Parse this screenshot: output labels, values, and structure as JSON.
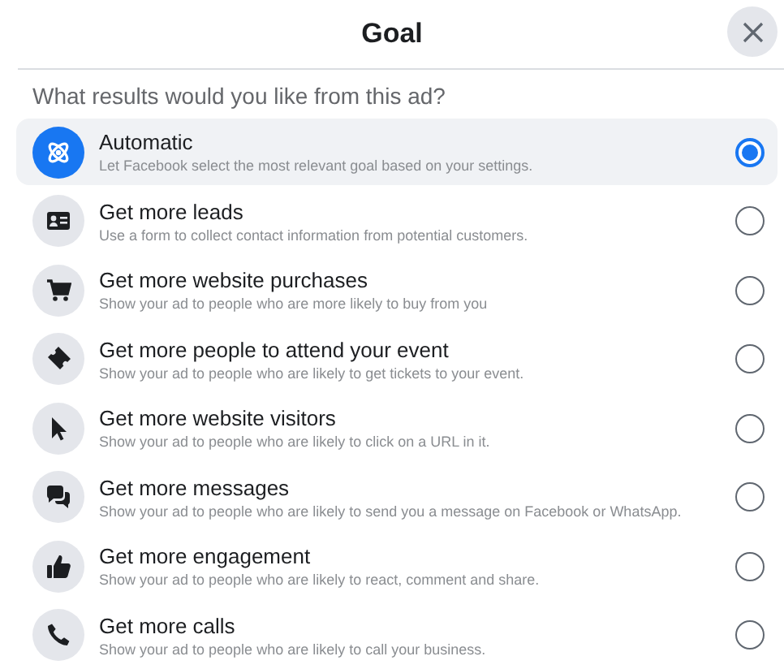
{
  "dialog": {
    "title": "Goal",
    "question": "What results would you like from this ad?"
  },
  "goals": [
    {
      "title": "Automatic",
      "description": "Let Facebook select the most relevant goal based on your settings.",
      "selected": true
    },
    {
      "title": "Get more leads",
      "description": "Use a form to collect contact information from potential customers.",
      "selected": false
    },
    {
      "title": "Get more website purchases",
      "description": "Show your ad to people who are more likely to buy from you",
      "selected": false
    },
    {
      "title": "Get more people to attend your event",
      "description": "Show your ad to people who are likely to get tickets to your event.",
      "selected": false
    },
    {
      "title": "Get more website visitors",
      "description": "Show your ad to people who are likely to click on a URL in it.",
      "selected": false
    },
    {
      "title": "Get more messages",
      "description": "Show your ad to people who are likely to send you a message on Facebook or WhatsApp.",
      "selected": false
    },
    {
      "title": "Get more engagement",
      "description": "Show your ad to people who are likely to react, comment and share.",
      "selected": false
    },
    {
      "title": "Get more calls",
      "description": "Show your ad to people who are likely to call your business.",
      "selected": false
    }
  ]
}
